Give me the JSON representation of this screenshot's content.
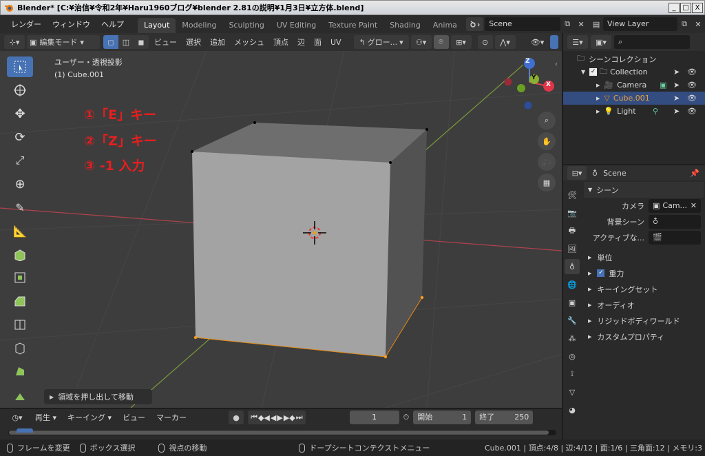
{
  "window": {
    "title": "Blender* [C:¥治信¥令和2年¥Haru1960ブログ¥blender 2.81の説明¥1月3日¥立方体.blend]",
    "minimize": "_",
    "maximize": "□",
    "close": "X"
  },
  "menubar": {
    "items": [
      "レンダー",
      "ウィンドウ",
      "ヘルプ"
    ],
    "tabs": [
      {
        "label": "Layout",
        "active": true
      },
      {
        "label": "Modeling",
        "active": false
      },
      {
        "label": "Sculpting",
        "active": false
      },
      {
        "label": "UV Editing",
        "active": false
      },
      {
        "label": "Texture Paint",
        "active": false
      },
      {
        "label": "Shading",
        "active": false
      },
      {
        "label": "Anima",
        "active": false
      }
    ],
    "scene": "Scene",
    "view_layer": "View Layer"
  },
  "viewport_header": {
    "mode": "編集モード",
    "menus": [
      "ビュー",
      "選択",
      "追加",
      "メッシュ",
      "頂点",
      "辺",
      "面",
      "UV"
    ],
    "transform": "グロー..."
  },
  "viewport": {
    "view_label": "ユーザー・透視投影",
    "object_label": "(1) Cube.001",
    "instructions": [
      "①「E」キー",
      "②「Z」キー",
      "③ -1 入力"
    ],
    "hint": "領域を押し出して移動",
    "gizmo": {
      "z": "Z",
      "y": "Y",
      "x": "X"
    }
  },
  "outliner": {
    "search_placeholder": "",
    "root": "シーンコレクション",
    "collection": "Collection",
    "items": [
      {
        "name": "Camera",
        "selected": false
      },
      {
        "name": "Cube.001",
        "selected": true
      },
      {
        "name": "Light",
        "selected": false
      }
    ]
  },
  "properties": {
    "header": "Scene",
    "section": "シーン",
    "camera_label": "カメラ",
    "camera_value": "Cam...",
    "bg_scene_label": "背景シーン",
    "active_label": "アクティブな...",
    "panels": [
      "単位",
      "重力",
      "キーイングセット",
      "オーディオ",
      "リジッドボディワールド",
      "カスタムプロパティ"
    ]
  },
  "timeline": {
    "playback": "再生",
    "keying": "キーイング",
    "view": "ビュー",
    "marker": "マーカー",
    "current_frame": "1",
    "start_label": "開始",
    "start": "1",
    "end_label": "終了",
    "end": "250"
  },
  "statusbar": {
    "left1": "フレームを変更",
    "left2": "ボックス選択",
    "left3": "視点の移動",
    "mid": "ドープシートコンテクストメニュー",
    "stats": "Cube.001 | 頂点:4/8 | 辺:4/12 | 面:1/6 | 三角面:12 | メモリ:3"
  },
  "colors": {
    "accent": "#4772b3",
    "annotation": "#e81e1e",
    "selected_row": "#334d80"
  }
}
